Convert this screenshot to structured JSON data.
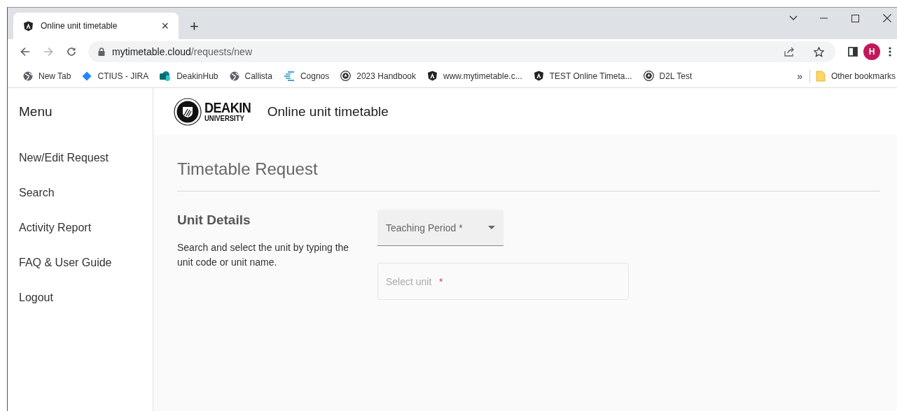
{
  "browser": {
    "tab": {
      "title": "Online unit timetable",
      "close": "×",
      "selected": true
    },
    "new_tab": "+",
    "address": {
      "host": "mytimetable.cloud",
      "path": "/requests/new"
    },
    "avatar": "H",
    "bookmarks": [
      {
        "label": "New Tab",
        "kind": "globe"
      },
      {
        "label": "CTIUS - JIRA",
        "kind": "diamond"
      },
      {
        "label": "DeakinHub",
        "kind": "sharepoint"
      },
      {
        "label": "Callista",
        "kind": "globe"
      },
      {
        "label": "Cognos",
        "kind": "cognos"
      },
      {
        "label": "2023 Handbook",
        "kind": "badge"
      },
      {
        "label": "www.mytimetable.c...",
        "kind": "shield"
      },
      {
        "label": "TEST Online Timeta...",
        "kind": "shield"
      },
      {
        "label": "D2L Test",
        "kind": "badge"
      }
    ],
    "overflow": "»",
    "other_bookmarks": "Other bookmarks"
  },
  "sidebar": {
    "title": "Menu",
    "items": [
      {
        "label": "New/Edit Request"
      },
      {
        "label": "Search"
      },
      {
        "label": "Activity Report"
      },
      {
        "label": "FAQ & User Guide"
      },
      {
        "label": "Logout"
      }
    ]
  },
  "header": {
    "logo": {
      "name": "DEAKIN",
      "sub": "UNIVERSITY"
    },
    "title": "Online unit timetable"
  },
  "page": {
    "heading": "Timetable Request",
    "section": {
      "title": "Unit Details",
      "description": "Search and select the unit by typing the unit code or unit name."
    },
    "teaching_period": {
      "label": "Teaching Period *"
    },
    "unit_field": {
      "placeholder": "Select unit",
      "required_mark": "*"
    }
  }
}
